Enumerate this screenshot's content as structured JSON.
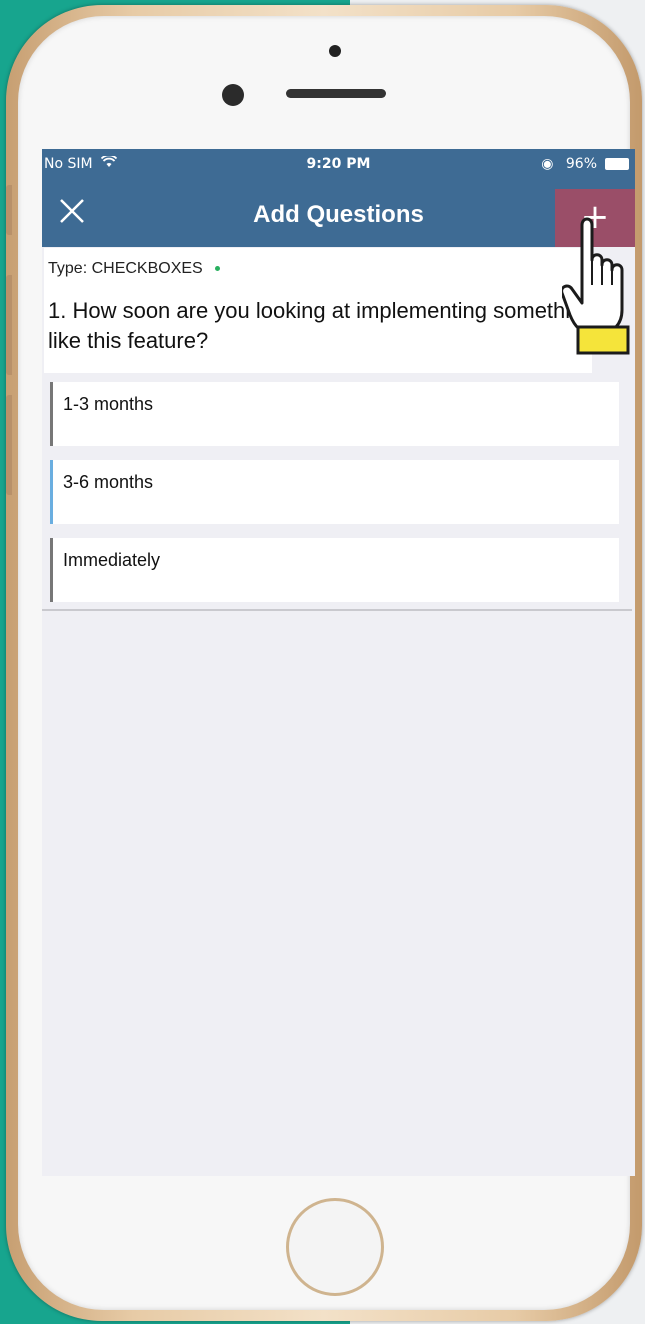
{
  "status_bar": {
    "carrier": "No SIM",
    "time": "9:20 PM",
    "battery": "96%"
  },
  "nav": {
    "title": "Add Questions",
    "add_label": "+"
  },
  "question": {
    "type_label": "Type: CHECKBOXES",
    "text": "1. How soon are you looking at implementing something like this feature?"
  },
  "options": [
    {
      "label": "1-3 months"
    },
    {
      "label": "3-6 months"
    },
    {
      "label": "Immediately"
    }
  ],
  "colors": {
    "nav_blue": "#3e6b94",
    "add_button": "#9a4e68",
    "background_teal": "#17a58e"
  },
  "icons": [
    "close-icon",
    "wifi-icon",
    "rotation-lock-icon",
    "battery-icon",
    "plus-icon",
    "pointer-hand-icon"
  ]
}
